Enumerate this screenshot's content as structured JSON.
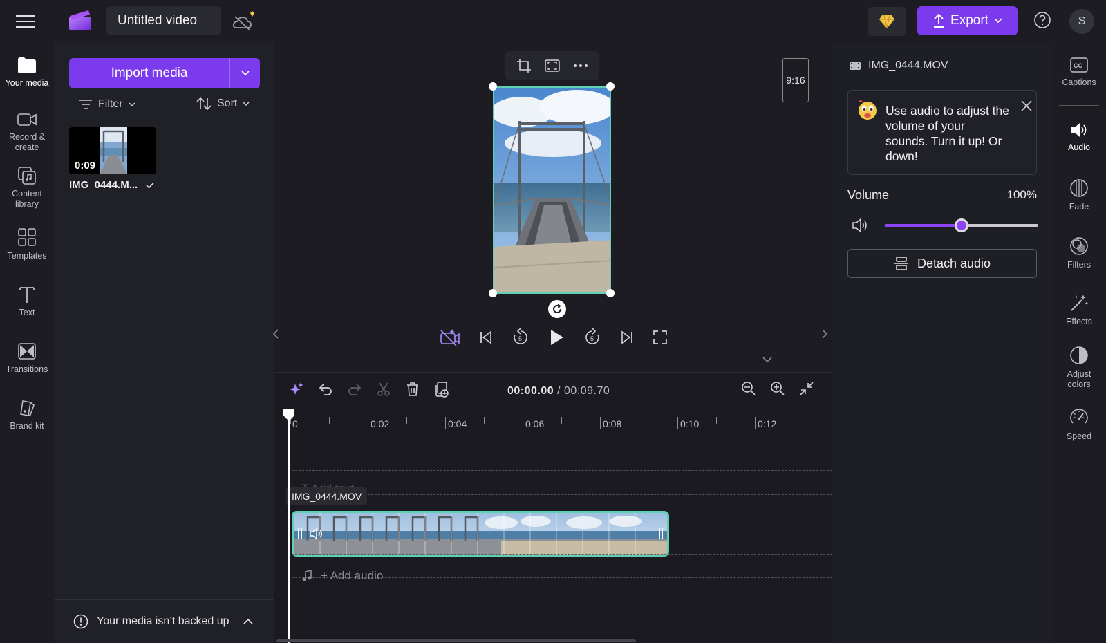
{
  "header": {
    "title": "Untitled video",
    "export_label": "Export",
    "avatar_initial": "S"
  },
  "left_nav": [
    {
      "label": "Your media",
      "icon": "folder-icon"
    },
    {
      "label": "Record & create",
      "icon": "video-camera-icon"
    },
    {
      "label": "Content library",
      "icon": "content-library-icon"
    },
    {
      "label": "Templates",
      "icon": "templates-icon"
    },
    {
      "label": "Text",
      "icon": "text-icon"
    },
    {
      "label": "Transitions",
      "icon": "transitions-icon"
    },
    {
      "label": "Brand kit",
      "icon": "brand-kit-icon"
    }
  ],
  "media": {
    "import_label": "Import media",
    "filter_label": "Filter",
    "sort_label": "Sort",
    "items": [
      {
        "name": "IMG_0444.M...",
        "duration": "0:09"
      }
    ],
    "backup_text": "Your media isn’t backed up"
  },
  "preview": {
    "aspect_ratio": "9:16"
  },
  "timeline": {
    "current_time": "00:00.00",
    "total_time": "/ 00:09.70",
    "ruler": [
      "0",
      "0:02",
      "0:04",
      "0:06",
      "0:08",
      "0:10",
      "0:12"
    ],
    "add_text": "T   Add text",
    "clip_label": "IMG_0444.MOV",
    "add_audio": "+ Add audio"
  },
  "properties": {
    "file_name": "IMG_0444.MOV",
    "tip_text": "Use audio to adjust the volume of your sounds. Turn it up! Or down!",
    "volume_label": "Volume",
    "volume_value": "100%",
    "volume_level": 0.5,
    "detach_label": "Detach audio"
  },
  "right_nav": [
    {
      "label": "Captions",
      "icon": "captions-icon"
    },
    {
      "label": "Audio",
      "icon": "speaker-icon"
    },
    {
      "label": "Fade",
      "icon": "fade-icon"
    },
    {
      "label": "Filters",
      "icon": "filters-icon"
    },
    {
      "label": "Effects",
      "icon": "magic-wand-icon"
    },
    {
      "label": "Adjust colors",
      "icon": "adjust-colors-icon"
    },
    {
      "label": "Speed",
      "icon": "speedometer-icon"
    }
  ],
  "colors": {
    "accent": "#7c3aed",
    "selection": "#5fcfb6"
  }
}
